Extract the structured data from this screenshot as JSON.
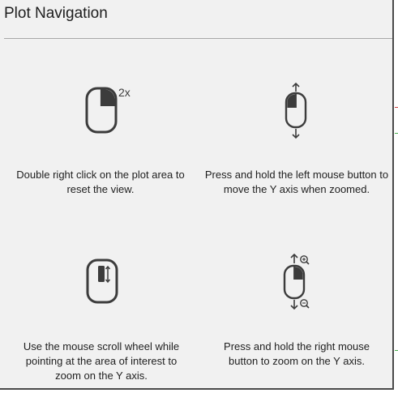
{
  "dialog": {
    "title": "Plot Navigation"
  },
  "tips": [
    {
      "icon": "mouse-double-right-click-icon",
      "badge": "2x",
      "text": "Double right click on the plot area to reset the view."
    },
    {
      "icon": "mouse-left-drag-vertical-icon",
      "text": "Press and hold the left mouse button to move the Y axis when zoomed."
    },
    {
      "icon": "mouse-scroll-wheel-icon",
      "text": "Use the mouse scroll wheel while pointing at the area of interest to zoom on the Y axis."
    },
    {
      "icon": "mouse-right-drag-zoom-icon",
      "text": "Press and hold the right mouse button to zoom on the Y axis."
    }
  ],
  "colors": {
    "panel_background": "#f1f1f1",
    "icon_stroke": "#3c3c3c",
    "text": "#1e1e1e",
    "divider": "#a8a8a8"
  }
}
